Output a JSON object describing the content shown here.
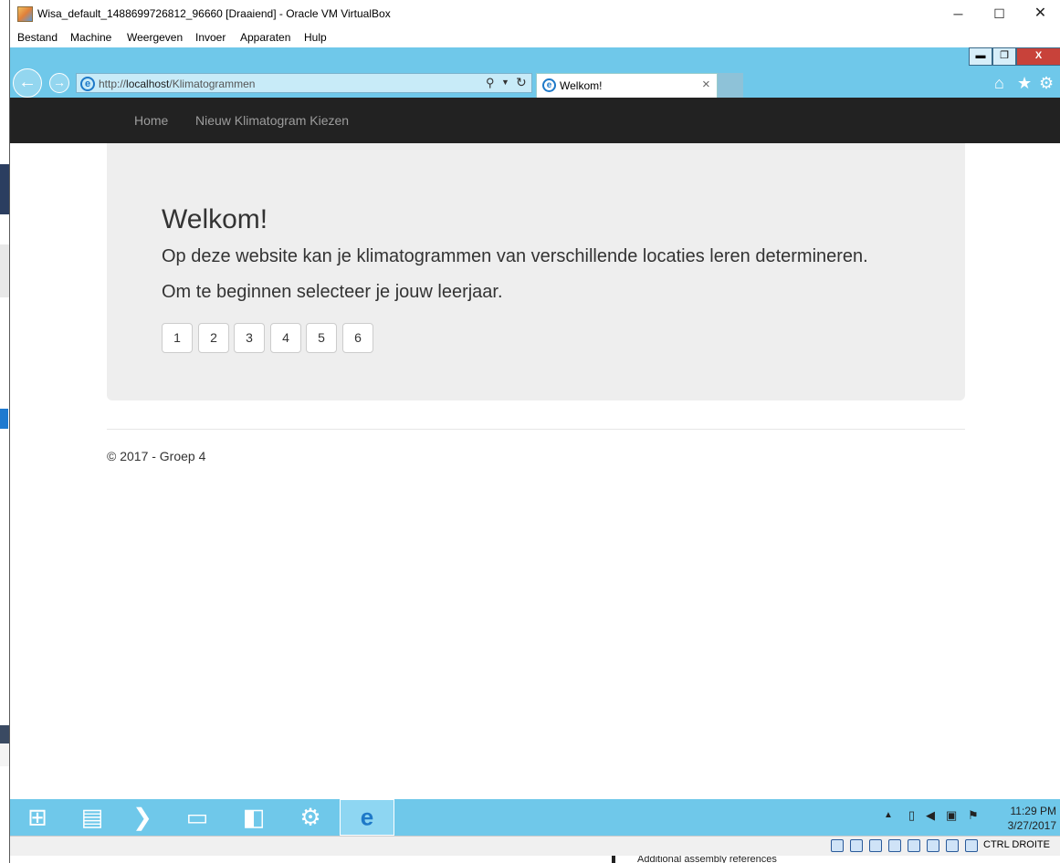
{
  "window": {
    "title": "Wisa_default_1488699726812_96660 [Draaiend] - Oracle VM VirtualBox",
    "minimize": "─",
    "maximize": "☐",
    "close": "✕"
  },
  "menubar": [
    "Bestand",
    "Machine",
    "Weergeven",
    "Invoer",
    "Apparaten",
    "Hulp"
  ],
  "browser": {
    "url_prefix": "http://",
    "url_host": "localhost",
    "url_path": "/Klimatogrammen",
    "tab_title": "Welkom!",
    "tab_close": "×",
    "ie_ctrl_min": "▬",
    "ie_ctrl_restore": "❐",
    "ie_ctrl_close": "X"
  },
  "site": {
    "nav": [
      "Home",
      "Nieuw Klimatogram Kiezen"
    ],
    "heading": "Welkom!",
    "lead1": "Op deze website kan je klimatogrammen van verschillende locaties leren determineren.",
    "lead2": "Om te beginnen selecteer je jouw leerjaar.",
    "years": [
      "1",
      "2",
      "3",
      "4",
      "5",
      "6"
    ],
    "footer": "© 2017 - Groep 4"
  },
  "taskbar": {
    "time": "11:29 PM",
    "date": "3/27/2017"
  },
  "statusbar": {
    "host_key": "CTRL DROITE"
  },
  "host_behind": {
    "text": "Additional assembly references"
  }
}
